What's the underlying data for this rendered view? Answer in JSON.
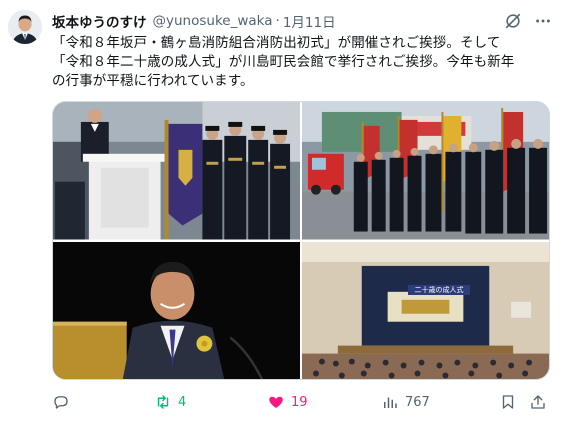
{
  "author": {
    "display_name": "坂本ゆうのすけ",
    "handle": "@yunosuke_waka",
    "separator": "·",
    "date": "1月11日",
    "avatar_icon": "avatar-photo"
  },
  "tweet": {
    "lines": [
      "「令和８年坂戸・鶴ヶ島消防組合消防出初式」が開催されご挨拶。そして",
      "「令和８年二十歳の成人式」が川島町民会館で挙行されご挨拶。今年も新年",
      "の行事が平穏に行われています。"
    ]
  },
  "header_icons": [
    "grok-icon",
    "more-options-icon"
  ],
  "photos": [
    {
      "name": "photo-ceremony-speech"
    },
    {
      "name": "photo-firefighter-parade"
    },
    {
      "name": "photo-speaker-portrait"
    },
    {
      "name": "photo-coming-of-age-hall",
      "banner_text": "二十歳の成人式"
    }
  ],
  "actions": {
    "reply_count": "",
    "retweet_count": "4",
    "like_count": "19",
    "views_count": "767"
  },
  "colors": {
    "text": "#0f1419",
    "muted": "#536471",
    "retweet": "#00ba7c",
    "like": "#f91880",
    "border": "#cfd9de"
  }
}
